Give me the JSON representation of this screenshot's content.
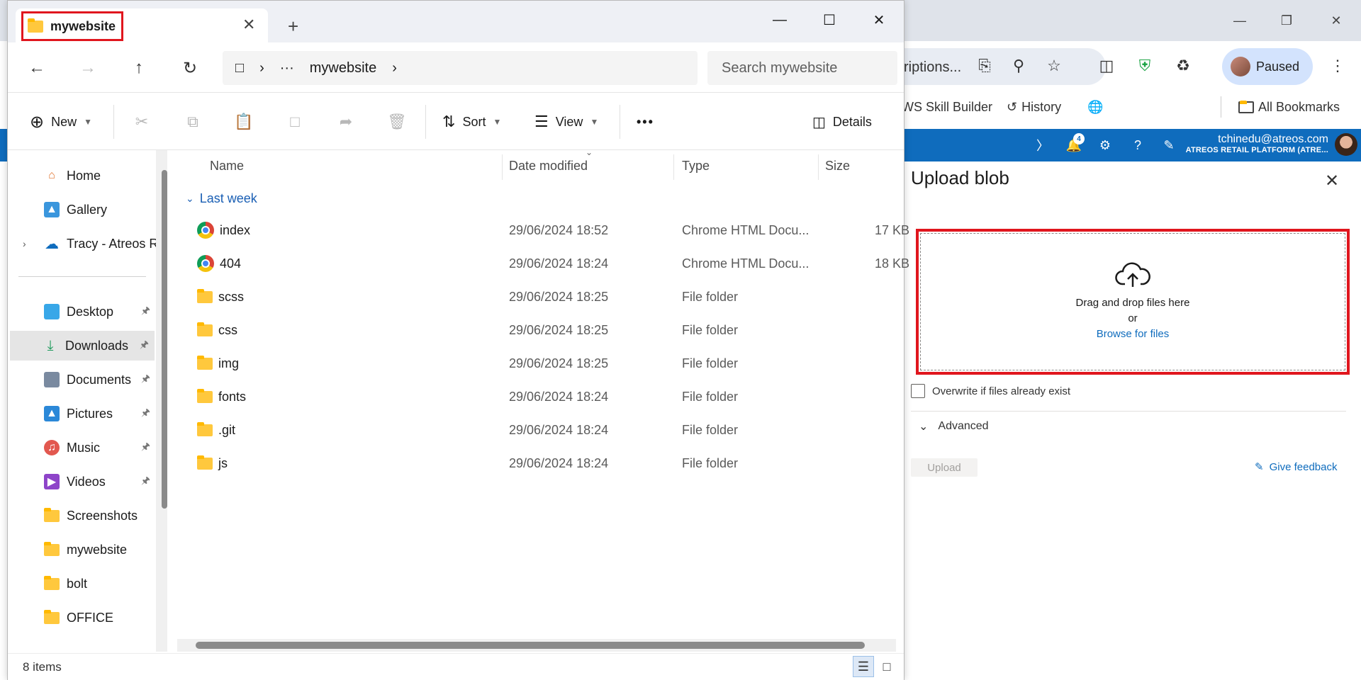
{
  "chrome": {
    "omnibox_text": "riptions...",
    "paused_label": "Paused",
    "bookmarks": [
      "WS Skill Builder",
      "History",
      "All Bookmarks"
    ]
  },
  "azure": {
    "notifications_count": "4",
    "email": "tchinedu@atreos.com",
    "tenant": "ATREOS RETAIL PLATFORM (ATRE..."
  },
  "upload_panel": {
    "title": "Upload blob",
    "drag_text": "Drag and drop files here",
    "or_text": "or",
    "browse_link": "Browse for files",
    "overwrite_label": "Overwrite if files already exist",
    "advanced_label": "Advanced",
    "upload_button": "Upload",
    "feedback_link": "Give feedback"
  },
  "explorer": {
    "tab_title": "mywebsite",
    "address": {
      "ellipsis": "···",
      "folder": "mywebsite"
    },
    "search_placeholder": "Search mywebsite",
    "commands": {
      "new": "New",
      "sort": "Sort",
      "view": "View",
      "more": "•••",
      "details": "Details"
    },
    "sidebar": [
      {
        "label": "Home"
      },
      {
        "label": "Gallery"
      },
      {
        "label": "Tracy - Atreos Re"
      },
      {
        "label": "Desktop"
      },
      {
        "label": "Downloads"
      },
      {
        "label": "Documents"
      },
      {
        "label": "Pictures"
      },
      {
        "label": "Music"
      },
      {
        "label": "Videos"
      },
      {
        "label": "Screenshots"
      },
      {
        "label": "mywebsite"
      },
      {
        "label": "bolt"
      },
      {
        "label": "OFFICE"
      }
    ],
    "columns": {
      "name": "Name",
      "date": "Date modified",
      "type": "Type",
      "size": "Size"
    },
    "group": "Last week",
    "files": [
      {
        "name": "index",
        "date": "29/06/2024 18:52",
        "type": "Chrome HTML Docu...",
        "size": "17 KB",
        "kind": "chrome"
      },
      {
        "name": "404",
        "date": "29/06/2024 18:24",
        "type": "Chrome HTML Docu...",
        "size": "18 KB",
        "kind": "chrome"
      },
      {
        "name": "scss",
        "date": "29/06/2024 18:25",
        "type": "File folder",
        "size": "",
        "kind": "folder"
      },
      {
        "name": "css",
        "date": "29/06/2024 18:25",
        "type": "File folder",
        "size": "",
        "kind": "folder"
      },
      {
        "name": "img",
        "date": "29/06/2024 18:25",
        "type": "File folder",
        "size": "",
        "kind": "folder"
      },
      {
        "name": "fonts",
        "date": "29/06/2024 18:24",
        "type": "File folder",
        "size": "",
        "kind": "folder"
      },
      {
        "name": ".git",
        "date": "29/06/2024 18:24",
        "type": "File folder",
        "size": "",
        "kind": "folder"
      },
      {
        "name": "js",
        "date": "29/06/2024 18:24",
        "type": "File folder",
        "size": "",
        "kind": "folder"
      }
    ],
    "status_count": "8 items"
  }
}
